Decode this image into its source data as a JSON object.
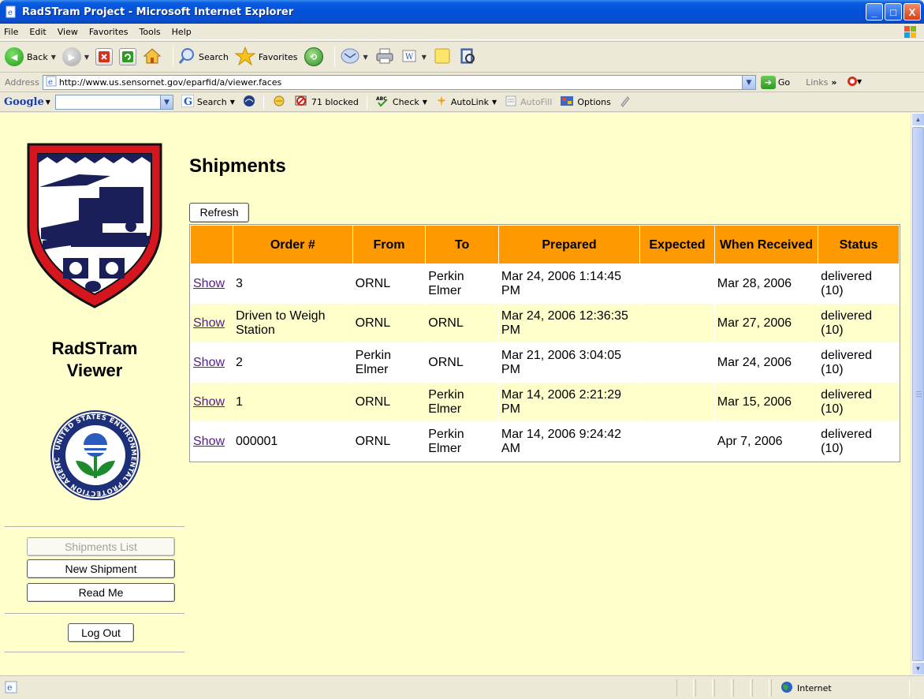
{
  "window": {
    "title": "RadSTram Project - Microsoft Internet Explorer",
    "minimize": "_",
    "maximize": "□",
    "close": "X"
  },
  "menu": [
    "File",
    "Edit",
    "View",
    "Favorites",
    "Tools",
    "Help"
  ],
  "toolbar": {
    "back_label": "Back",
    "search_label": "Search",
    "favorites_label": "Favorites"
  },
  "address": {
    "label": "Address",
    "url": "http://www.us.sensornet.gov/eparfid/a/viewer.faces",
    "go_label": "Go",
    "links_label": "Links"
  },
  "google": {
    "logo": "Google",
    "search_label": "Search",
    "blocked_label": "71 blocked",
    "check_label": "Check",
    "autolink_label": "AutoLink",
    "autofill_label": "AutoFill",
    "options_label": "Options"
  },
  "sidebar": {
    "title_line1": "RadSTram",
    "title_line2": "Viewer",
    "seal_text": "UNITED STATES ENVIRONMENTAL PROTECTION AGENCY",
    "buttons": {
      "shipments_list": "Shipments List",
      "new_shipment": "New Shipment",
      "read_me": "Read Me",
      "log_out": "Log Out"
    }
  },
  "main": {
    "title": "Shipments",
    "refresh_label": "Refresh",
    "columns": [
      "",
      "Order #",
      "From",
      "To",
      "Prepared",
      "Expected",
      "When Received",
      "Status"
    ],
    "rows": [
      {
        "link": "Show",
        "order": "3",
        "from": "ORNL",
        "to": "Perkin Elmer",
        "prepared": "Mar 24, 2006 1:14:45 PM",
        "expected": "",
        "received": "Mar 28, 2006",
        "status": "delivered (10)"
      },
      {
        "link": "Show",
        "order": "Driven to Weigh Station",
        "from": "ORNL",
        "to": "ORNL",
        "prepared": "Mar 24, 2006 12:36:35 PM",
        "expected": "",
        "received": "Mar 27, 2006",
        "status": "delivered (10)"
      },
      {
        "link": "Show",
        "order": "2",
        "from": "Perkin Elmer",
        "to": "ORNL",
        "prepared": "Mar 21, 2006 3:04:05 PM",
        "expected": "",
        "received": "Mar 24, 2006",
        "status": "delivered (10)"
      },
      {
        "link": "Show",
        "order": "1",
        "from": "ORNL",
        "to": "Perkin Elmer",
        "prepared": "Mar 14, 2006 2:21:29 PM",
        "expected": "",
        "received": "Mar 15, 2006",
        "status": "delivered (10)"
      },
      {
        "link": "Show",
        "order": "000001",
        "from": "ORNL",
        "to": "Perkin Elmer",
        "prepared": "Mar 14, 2006 9:24:42 AM",
        "expected": "",
        "received": "Apr 7, 2006",
        "status": "delivered (10)"
      }
    ]
  },
  "status": {
    "zone": "Internet"
  },
  "colors": {
    "page_bg": "#ffffcc",
    "header_bg": "#ff9900",
    "link": "#551a8b",
    "titlebar": "#0350d8"
  }
}
